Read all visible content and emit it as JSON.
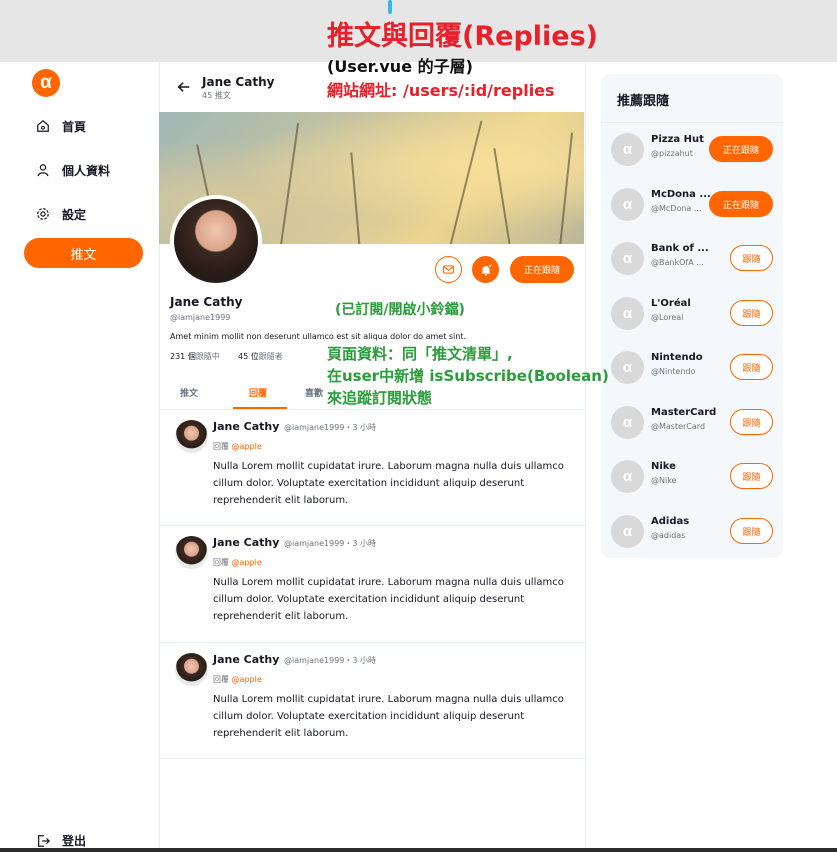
{
  "colors": {
    "brand": "#ff6600",
    "annotation_red": "#e8202a",
    "annotation_green": "#2a9c3a"
  },
  "sidebar": {
    "logo_icon": "ac-logo-icon",
    "items": [
      {
        "label": "首頁",
        "icon": "home-icon"
      },
      {
        "label": "個人資料",
        "icon": "user-icon"
      },
      {
        "label": "設定",
        "icon": "gear-icon"
      }
    ],
    "tweet_button": "推文",
    "logout": "登出"
  },
  "profile": {
    "header_name": "Jane Cathy",
    "header_count": "45 推文",
    "name": "Jane Cathy",
    "handle": "@iamjane1999",
    "bio": "Amet minim mollit non deserunt ullamco est sit aliqua dolor do amet sint.",
    "following_count": "231 個",
    "following_label": "跟隨中",
    "followers_count": "45 位",
    "followers_label": "跟隨者",
    "follow_button": "正在跟隨"
  },
  "tabs": [
    "推文",
    "回覆",
    "喜歡"
  ],
  "replies": [
    {
      "name": "Jane Cathy",
      "meta": "@iamjane1999・3 小時",
      "reply_prefix": "回覆",
      "reply_to": "@apple",
      "body": "Nulla Lorem mollit cupidatat irure. Laborum magna nulla duis ullamco cillum dolor. Voluptate exercitation incididunt aliquip deserunt reprehenderit elit laborum."
    },
    {
      "name": "Jane Cathy",
      "meta": "@iamjane1999・3 小時",
      "reply_prefix": "回覆",
      "reply_to": "@apple",
      "body": "Nulla Lorem mollit cupidatat irure. Laborum magna nulla duis ullamco cillum dolor. Voluptate exercitation incididunt aliquip deserunt reprehenderit elit laborum."
    },
    {
      "name": "Jane Cathy",
      "meta": "@iamjane1999・3 小時",
      "reply_prefix": "回覆",
      "reply_to": "@apple",
      "body": "Nulla Lorem mollit cupidatat irure. Laborum magna nulla duis ullamco cillum dolor. Voluptate exercitation incididunt aliquip deserunt reprehenderit elit laborum."
    }
  ],
  "recommend": {
    "title": "推薦跟隨",
    "users": [
      {
        "name": "Pizza Hut",
        "handle": "@pizzahut",
        "button": "正在跟隨",
        "following": true
      },
      {
        "name": "McDona ...",
        "handle": "@McDona ...",
        "button": "正在跟隨",
        "following": true
      },
      {
        "name": "Bank of ...",
        "handle": "@BankOfA ...",
        "button": "跟隨",
        "following": false
      },
      {
        "name": "L'Oréal",
        "handle": "@Loreal",
        "button": "跟隨",
        "following": false
      },
      {
        "name": "Nintendo",
        "handle": "@Nintendo",
        "button": "跟隨",
        "following": false
      },
      {
        "name": "MasterCard",
        "handle": "@MasterCard",
        "button": "跟隨",
        "following": false
      },
      {
        "name": "Nike",
        "handle": "@Nike",
        "button": "跟隨",
        "following": false
      },
      {
        "name": "Adidas",
        "handle": "@adidas",
        "button": "跟隨",
        "following": false
      }
    ]
  },
  "annotations": {
    "title": "推文與回覆(Replies)",
    "subtitle": "(User.vue 的子層)",
    "url": "網站網址: /users/:id/replies",
    "bell": "(已訂閱/開啟小鈴鐺)",
    "data_line1": "頁面資料：同「推文清單」,",
    "data_line2": "在user中新增 isSubscribe(Boolean)",
    "data_line3": "來追蹤訂閱狀態"
  }
}
